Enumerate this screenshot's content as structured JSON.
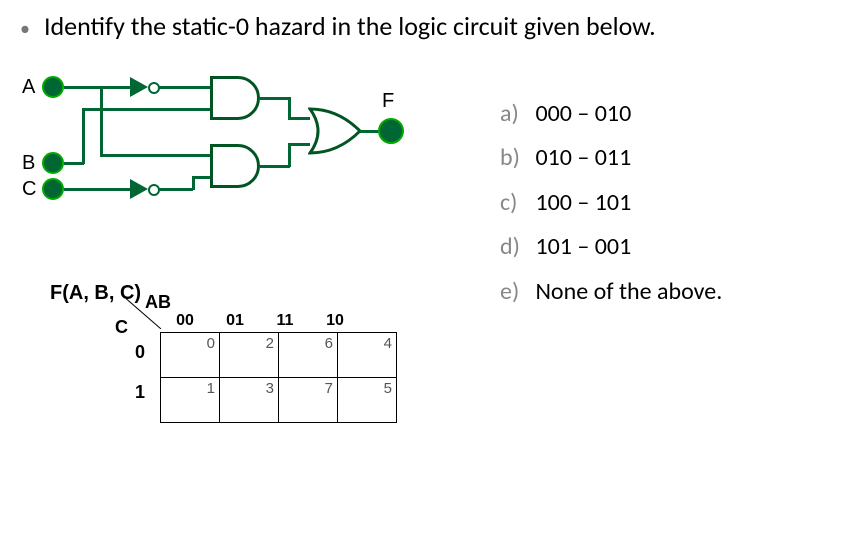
{
  "question": "Identify the static-0 hazard in the logic circuit given below.",
  "circuit": {
    "inputs": [
      "A",
      "B",
      "C"
    ],
    "output": "F"
  },
  "kmap": {
    "title": "F(A, B, C)",
    "col_var": "AB",
    "row_var": "C",
    "col_headers": [
      "00",
      "01",
      "11",
      "10"
    ],
    "row_headers": [
      "0",
      "1"
    ],
    "cells": [
      [
        "0",
        "2",
        "6",
        "4"
      ],
      [
        "1",
        "3",
        "7",
        "5"
      ]
    ]
  },
  "options": [
    {
      "letter": "a)",
      "value": "000 – 010"
    },
    {
      "letter": "b)",
      "value": "010 – 011"
    },
    {
      "letter": "c)",
      "value": "100 – 101"
    },
    {
      "letter": "d)",
      "value": "101 – 001"
    },
    {
      "letter": "e)",
      "value": "None of the above."
    }
  ]
}
